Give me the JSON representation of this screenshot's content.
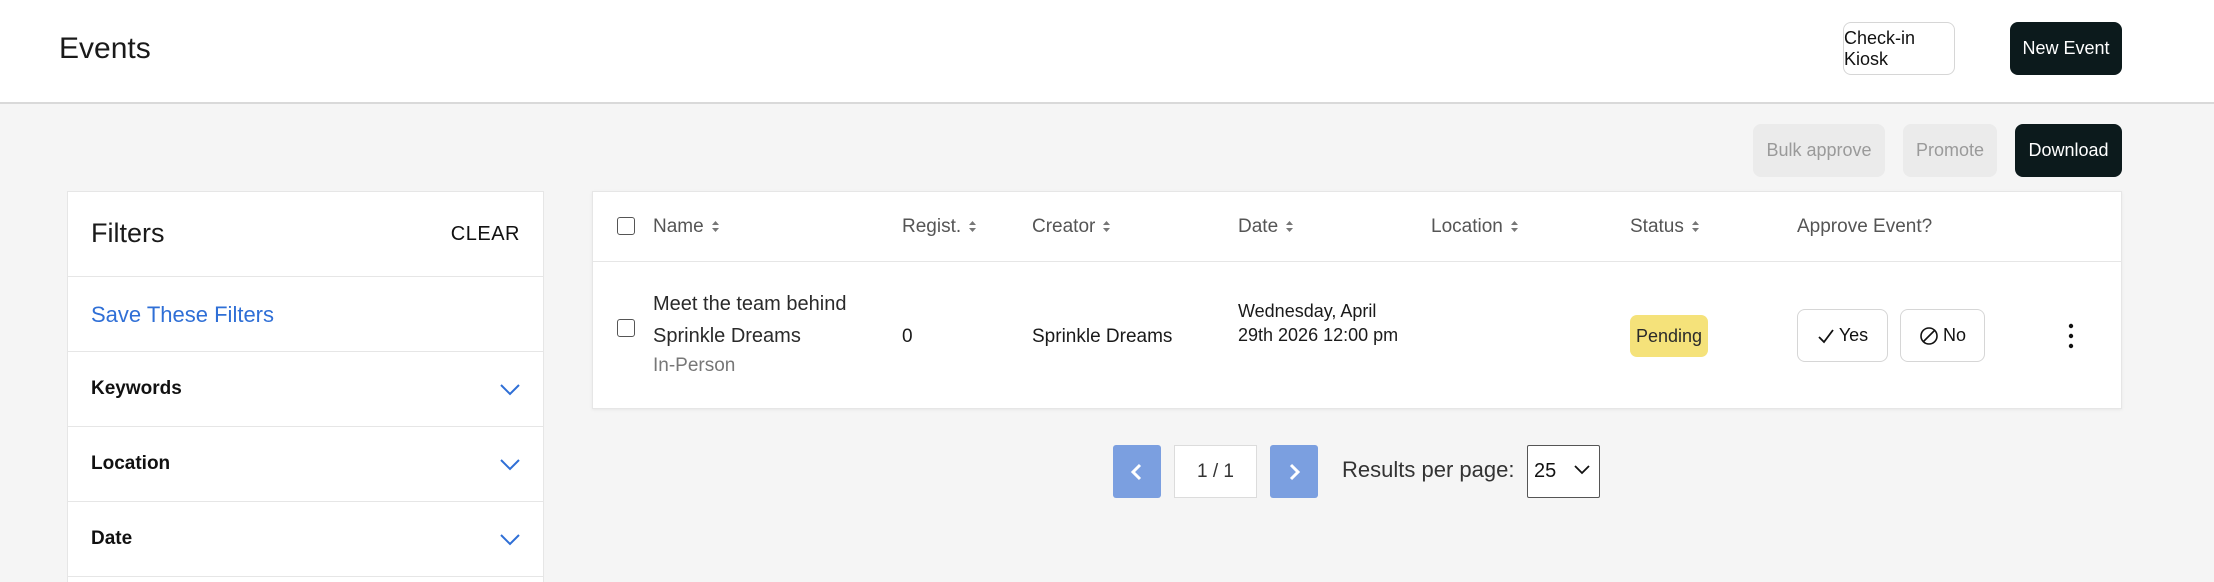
{
  "header": {
    "title": "Events",
    "kiosk_label": "Check-in Kiosk",
    "new_event_label": "New Event"
  },
  "toolbar": {
    "bulk_approve_label": "Bulk approve",
    "promote_label": "Promote",
    "download_label": "Download"
  },
  "filters": {
    "title": "Filters",
    "clear_label": "CLEAR",
    "save_label": "Save These Filters",
    "sections": [
      {
        "label": "Keywords"
      },
      {
        "label": "Location"
      },
      {
        "label": "Date"
      }
    ]
  },
  "table": {
    "columns": {
      "name": "Name",
      "regist": "Regist.",
      "creator": "Creator",
      "date": "Date",
      "location": "Location",
      "status": "Status",
      "approve": "Approve Event?"
    },
    "rows": [
      {
        "name": "Meet the team behind Sprinkle Dreams",
        "type": "In-Person",
        "registrations": "0",
        "creator": "Sprinkle Dreams",
        "date": "Wednesday, April 29th 2026 12:00 pm",
        "location": "",
        "status": "Pending",
        "approve_yes": "Yes",
        "approve_no": "No"
      }
    ]
  },
  "pagination": {
    "page": "1 / 1",
    "results_label": "Results per page:",
    "per_page": "25"
  },
  "colors": {
    "primary_dark": "#0c1a1c",
    "link_blue": "#2f6fd6",
    "pending_badge": "#f5e27a",
    "pager_blue": "#7b9fe0"
  }
}
